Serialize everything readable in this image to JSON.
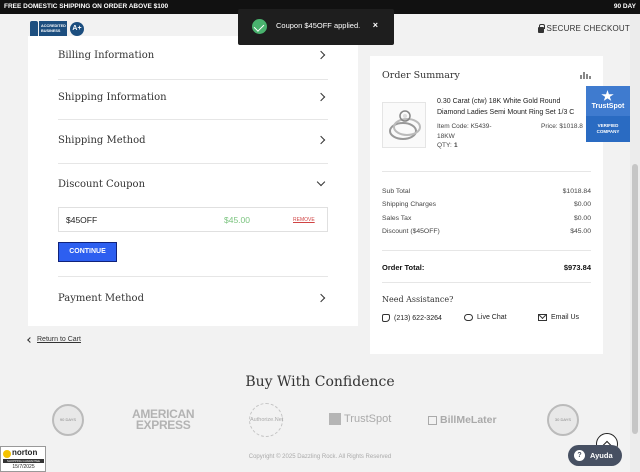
{
  "topbar": {
    "promo": "FREE DOMESTIC SHIPPING ON ORDER ABOVE $100",
    "right_text": "90 DAY"
  },
  "header": {
    "bbb_text": "ACCREDITED BUSINESS",
    "bbb_rating": "A+",
    "secure_checkout": "SECURE CHECKOUT"
  },
  "toast": {
    "message": "Coupon $45OFF applied.",
    "close": "×"
  },
  "checkout_sections": {
    "billing": "Billing Information",
    "shipping": "Shipping Information",
    "method": "Shipping Method",
    "coupon": "Discount Coupon",
    "payment": "Payment Method"
  },
  "coupon": {
    "code": "$45OFF",
    "amount": "$45.00",
    "remove_label": "REMOVE",
    "continue_label": "CONTINUE"
  },
  "order_summary": {
    "title": "Order Summary",
    "product": {
      "name_line1": "0.30 Carat (ctw) 18K White Gold Round",
      "name_line2": "Diamond Ladies Semi Mount Ring Set 1/3 C",
      "item_code_label": "Item Code: K5439-",
      "item_code_line2": "18KW",
      "price_label": "Price: $1018.8",
      "qty_label": "QTY:",
      "qty": "1"
    },
    "rows": [
      {
        "label": "Sub Total",
        "value": "$1018.84"
      },
      {
        "label": "Shipping Charges",
        "value": "$0.00"
      },
      {
        "label": "Sales Tax",
        "value": "$0.00"
      },
      {
        "label": "Discount ($45OFF)",
        "value": "$45.00"
      }
    ],
    "total_label": "Order Total:",
    "total_value": "$973.84",
    "need_assistance": "Need Assistance?",
    "phone": "(213) 622-3264",
    "live_chat": "Live Chat",
    "email": "Email Us"
  },
  "trustspot": {
    "name": "TrustSpot",
    "verified": "VERIFIED",
    "company": "COMPANY"
  },
  "return_link": "Return to Cart",
  "confidence": {
    "title": "Buy With Confidence",
    "seal1": "90 DAYS",
    "amex_line1": "AMERICAN",
    "amex_line2": "EXPRESS",
    "authnet": "Authorize.Net",
    "trustspot": "TrustSpot",
    "billmelater": "BillMeLater",
    "seal2": "30 DAYS"
  },
  "footer": "Copyright © 2025 Dazzling Rock. All Rights Reserved",
  "norton": {
    "name": "norton",
    "guarantee": "SHOPPING GUARANTEE",
    "date": "15/7/2025"
  },
  "ayuda": "Ayuda",
  "colors": {
    "accent_button": "#2d5ff0",
    "toast_bg": "#1e1e1e",
    "toast_success": "#49b26e",
    "trustspot": "#2a6bc2",
    "coupon_amount": "#7bc47f",
    "remove_link": "#d04343"
  }
}
